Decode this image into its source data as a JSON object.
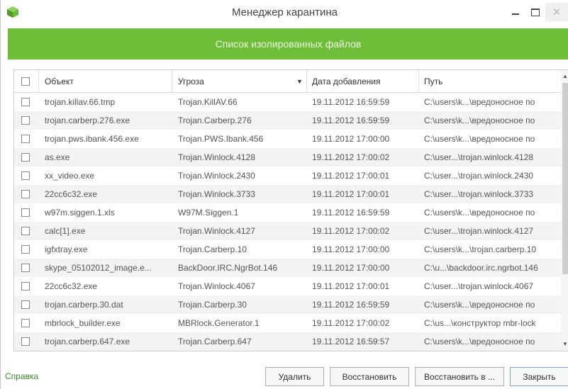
{
  "window": {
    "title": "Менеджер карантина",
    "min_glyph": "–",
    "max_glyph": "□",
    "close_glyph": "✕",
    "icon": "cube-icon",
    "accent": "#6fbe3a"
  },
  "header": {
    "banner": "Список изолированных файлов"
  },
  "table": {
    "columns": {
      "object": "Объект",
      "threat": "Угроза",
      "date": "Дата добавления",
      "path": "Путь"
    },
    "sort_indicator": "▼",
    "rows": [
      {
        "object": "trojan.killav.66.tmp",
        "threat": "Trojan.KillAV.66",
        "date": "19.11.2012 16:59:59",
        "path": "C:\\users\\k...\\вредоносное по"
      },
      {
        "object": "trojan.carberp.276.exe",
        "threat": "Trojan.Carberp.276",
        "date": "19.11.2012 16:59:59",
        "path": "C:\\users\\k...\\вредоносное по"
      },
      {
        "object": "trojan.pws.ibank.456.exe",
        "threat": "Trojan.PWS.Ibank.456",
        "date": "19.11.2012 17:00:00",
        "path": "C:\\users\\k...\\вредоносное по"
      },
      {
        "object": "as.exe",
        "threat": "Trojan.Winlock.4128",
        "date": "19.11.2012 17:00:02",
        "path": "C:\\user...\\trojan.winlock.4128"
      },
      {
        "object": "xx_video.exe",
        "threat": "Trojan.Winlock.2430",
        "date": "19.11.2012 17:00:01",
        "path": "C:\\user...\\trojan.winlock.2430"
      },
      {
        "object": "22cc6c32.exe",
        "threat": "Trojan.Winlock.3733",
        "date": "19.11.2012 17:00:01",
        "path": "C:\\user...\\trojan.winlock.3733"
      },
      {
        "object": "w97m.siggen.1.xls",
        "threat": "W97M.Siggen.1",
        "date": "19.11.2012 16:59:59",
        "path": "C:\\users\\k...\\вредоносное по"
      },
      {
        "object": "calc[1].exe",
        "threat": "Trojan.Winlock.4127",
        "date": "19.11.2012 17:00:02",
        "path": "C:\\user...\\trojan.winlock.4127"
      },
      {
        "object": "igfxtray.exe",
        "threat": "Trojan.Carberp.10",
        "date": "19.11.2012 17:00:00",
        "path": "C:\\users\\k...\\trojan.carberp.10"
      },
      {
        "object": "skype_05102012_image.e...",
        "threat": "BackDoor.IRC.NgrBot.146",
        "date": "19.11.2012 17:00:00",
        "path": "C:\\u...\\backdoor.irc.ngrbot.146"
      },
      {
        "object": "22cc6c32.exe",
        "threat": "Trojan.Winlock.4067",
        "date": "19.11.2012 17:00:01",
        "path": "C:\\user...\\trojan.winlock.4067"
      },
      {
        "object": "trojan.carberp.30.dat",
        "threat": "Trojan.Carberp.30",
        "date": "19.11.2012 16:59:59",
        "path": "C:\\users\\k...\\вредоносное по"
      },
      {
        "object": "mbrlock_builder.exe",
        "threat": "MBRlock.Generator.1",
        "date": "19.11.2012 17:00:02",
        "path": "C:\\us...\\конструктор mbr-lock"
      },
      {
        "object": "trojan.carberp.647.exe",
        "threat": "Trojan.Carberp.647",
        "date": "19.11.2012 16:59:57",
        "path": "C:\\users\\k...\\вредоносное по"
      }
    ]
  },
  "scrollbar": {
    "up_glyph": "▲",
    "down_glyph": "▼"
  },
  "footer": {
    "help": "Справка",
    "delete": "Удалить",
    "restore": "Восстановить",
    "restore_to": "Восстановить в ...",
    "close": "Закрыть"
  }
}
